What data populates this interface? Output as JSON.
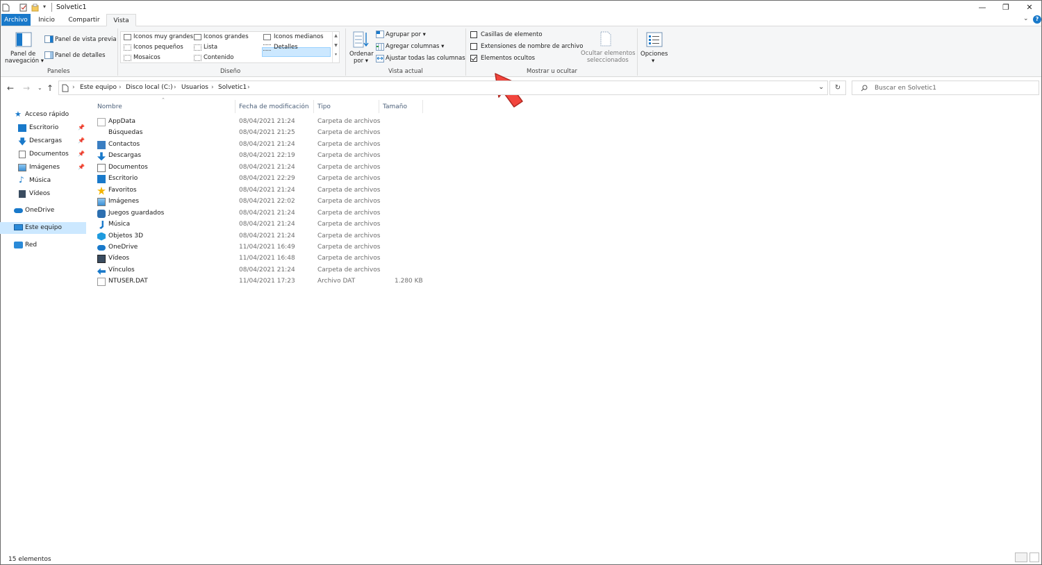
{
  "window": {
    "title": "Solvetic1",
    "minimize": "—",
    "restore": "❐",
    "close": "✕"
  },
  "tabs": [
    "Archivo",
    "Inicio",
    "Compartir",
    "Vista"
  ],
  "ribbon": {
    "paneles": {
      "nav_pane_line1": "Panel de",
      "nav_pane_line2": "navegación ▾",
      "preview": "Panel de vista previa",
      "details": "Panel de detalles",
      "label": "Paneles"
    },
    "diseno": {
      "items": [
        "Iconos muy grandes",
        "Iconos grandes",
        "Iconos medianos",
        "Iconos pequeños",
        "Lista",
        "Detalles",
        "Mosaicos",
        "Contenido"
      ],
      "selected": "Detalles",
      "label": "Diseño"
    },
    "vista_actual": {
      "sort_line1": "Ordenar",
      "sort_line2": "por ▾",
      "group_by": "Agrupar por ▾",
      "add_columns": "Agregar columnas ▾",
      "fit_columns": "Ajustar todas las columnas",
      "label": "Vista actual"
    },
    "mostrar": {
      "checkboxes": [
        {
          "label": "Casillas de elemento",
          "checked": false
        },
        {
          "label": "Extensiones de nombre de archivo",
          "checked": false
        },
        {
          "label": "Elementos ocultos",
          "checked": true
        }
      ],
      "hide_selected_line1": "Ocultar elementos",
      "hide_selected_line2": "seleccionados",
      "label": "Mostrar u ocultar"
    },
    "options": {
      "label": "Opciones",
      "caret": "▾"
    }
  },
  "address": {
    "crumbs": [
      "Este equipo",
      "Disco local (C:)",
      "Usuarios",
      "Solvetic1"
    ],
    "separator": "›",
    "dropdown": "⌄",
    "refresh": "↻"
  },
  "search": {
    "placeholder": "Buscar en Solvetic1"
  },
  "nav": {
    "quick_access": "Acceso rápido",
    "quick_items": [
      "Escritorio",
      "Descargas",
      "Documentos",
      "Imágenes",
      "Música",
      "Vídeos"
    ],
    "onedrive": "OneDrive",
    "this_pc": "Este equipo",
    "network": "Red"
  },
  "columns": {
    "name": "Nombre",
    "date": "Fecha de modificación",
    "type": "Tipo",
    "size": "Tamaño"
  },
  "files": [
    {
      "name": "AppData",
      "date": "08/04/2021 21:24",
      "type": "Carpeta de archivos",
      "size": "",
      "icon": "hidden-folder"
    },
    {
      "name": "Búsquedas",
      "date": "08/04/2021 21:25",
      "type": "Carpeta de archivos",
      "size": "",
      "icon": "search"
    },
    {
      "name": "Contactos",
      "date": "08/04/2021 21:24",
      "type": "Carpeta de archivos",
      "size": "",
      "icon": "contacts"
    },
    {
      "name": "Descargas",
      "date": "08/04/2021 22:19",
      "type": "Carpeta de archivos",
      "size": "",
      "icon": "download"
    },
    {
      "name": "Documentos",
      "date": "08/04/2021 21:24",
      "type": "Carpeta de archivos",
      "size": "",
      "icon": "document"
    },
    {
      "name": "Escritorio",
      "date": "08/04/2021 22:29",
      "type": "Carpeta de archivos",
      "size": "",
      "icon": "desktop"
    },
    {
      "name": "Favoritos",
      "date": "08/04/2021 21:24",
      "type": "Carpeta de archivos",
      "size": "",
      "icon": "star"
    },
    {
      "name": "Imágenes",
      "date": "08/04/2021 22:02",
      "type": "Carpeta de archivos",
      "size": "",
      "icon": "picture"
    },
    {
      "name": "Juegos guardados",
      "date": "08/04/2021 21:24",
      "type": "Carpeta de archivos",
      "size": "",
      "icon": "game"
    },
    {
      "name": "Música",
      "date": "08/04/2021 21:24",
      "type": "Carpeta de archivos",
      "size": "",
      "icon": "music"
    },
    {
      "name": "Objetos 3D",
      "date": "08/04/2021 21:24",
      "type": "Carpeta de archivos",
      "size": "",
      "icon": "cube"
    },
    {
      "name": "OneDrive",
      "date": "11/04/2021 16:49",
      "type": "Carpeta de archivos",
      "size": "",
      "icon": "cloud"
    },
    {
      "name": "Vídeos",
      "date": "11/04/2021 16:48",
      "type": "Carpeta de archivos",
      "size": "",
      "icon": "video"
    },
    {
      "name": "Vínculos",
      "date": "08/04/2021 21:24",
      "type": "Carpeta de archivos",
      "size": "",
      "icon": "link"
    },
    {
      "name": "NTUSER.DAT",
      "date": "11/04/2021 17:23",
      "type": "Archivo DAT",
      "size": "1.280 KB",
      "icon": "file"
    }
  ],
  "status": {
    "count": "15 elementos"
  },
  "colors": {
    "accent": "#1979ca",
    "selection": "#cce8ff",
    "arrow": "#f2453d"
  }
}
